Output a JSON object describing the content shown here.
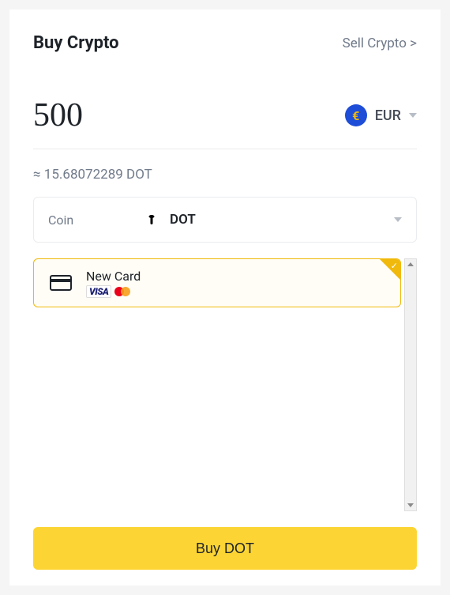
{
  "header": {
    "title": "Buy Crypto",
    "sell_link": "Sell Crypto >"
  },
  "amount": {
    "value": "500",
    "currency": {
      "symbol": "€",
      "code": "EUR"
    }
  },
  "conversion": {
    "approx_text": "≈ 15.68072289 DOT"
  },
  "coin_select": {
    "label": "Coin",
    "icon_symbol": "P",
    "code": "DOT"
  },
  "payment": {
    "new_card_label": "New Card",
    "logos": [
      "VISA",
      "mastercard"
    ]
  },
  "buy_button": {
    "label": "Buy DOT"
  }
}
